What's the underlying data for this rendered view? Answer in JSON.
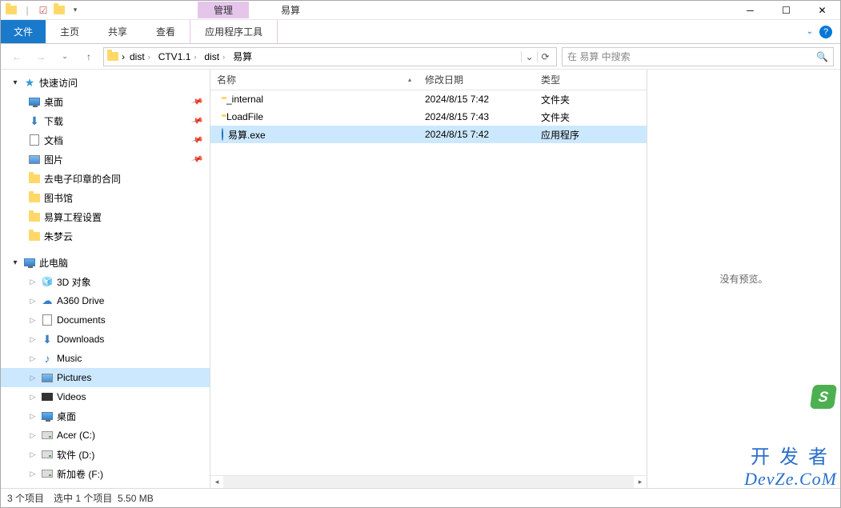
{
  "window": {
    "mgmt_tab": "管理",
    "title": "易算"
  },
  "ribbon": {
    "file": "文件",
    "home": "主页",
    "share": "共享",
    "view": "查看",
    "tools": "应用程序工具"
  },
  "addr": {
    "crumbs": [
      "dist",
      "CTV1.1",
      "dist",
      "易算"
    ]
  },
  "search": {
    "placeholder": "在 易算 中搜索"
  },
  "sidebar": {
    "quick": "快速访问",
    "items_pinned": [
      {
        "label": "桌面",
        "icon": "monitor"
      },
      {
        "label": "下载",
        "icon": "dl"
      },
      {
        "label": "文档",
        "icon": "doc"
      },
      {
        "label": "图片",
        "icon": "pic"
      }
    ],
    "items_recent": [
      {
        "label": "去电子印章的合同"
      },
      {
        "label": "图书馆"
      },
      {
        "label": "易算工程设置"
      },
      {
        "label": "朱梦云"
      }
    ],
    "this_pc": "此电脑",
    "pc_items": [
      {
        "label": "3D 对象",
        "icon": "threed"
      },
      {
        "label": "A360 Drive",
        "icon": "cloud"
      },
      {
        "label": "Documents",
        "icon": "doc"
      },
      {
        "label": "Downloads",
        "icon": "dl"
      },
      {
        "label": "Music",
        "icon": "music"
      },
      {
        "label": "Pictures",
        "icon": "pic",
        "selected": true
      },
      {
        "label": "Videos",
        "icon": "video"
      },
      {
        "label": "桌面",
        "icon": "monitor"
      },
      {
        "label": "Acer (C:)",
        "icon": "drive"
      },
      {
        "label": "软件 (D:)",
        "icon": "drive"
      },
      {
        "label": "新加卷 (F:)",
        "icon": "drive"
      }
    ]
  },
  "columns": {
    "name": "名称",
    "date": "修改日期",
    "type": "类型"
  },
  "files": [
    {
      "name": "_internal",
      "date": "2024/8/15 7:42",
      "type": "文件夹",
      "icon": "folder"
    },
    {
      "name": "LoadFile",
      "date": "2024/8/15 7:43",
      "type": "文件夹",
      "icon": "folder"
    },
    {
      "name": "易算.exe",
      "date": "2024/8/15 7:42",
      "type": "应用程序",
      "icon": "exe",
      "selected": true
    }
  ],
  "preview": {
    "text": "没有预览。"
  },
  "status": {
    "count": "3 个项目",
    "selected": "选中 1 个项目",
    "size": "5.50 MB"
  },
  "watermark": {
    "zh": "开发者",
    "en": "DevZe.CoM"
  }
}
